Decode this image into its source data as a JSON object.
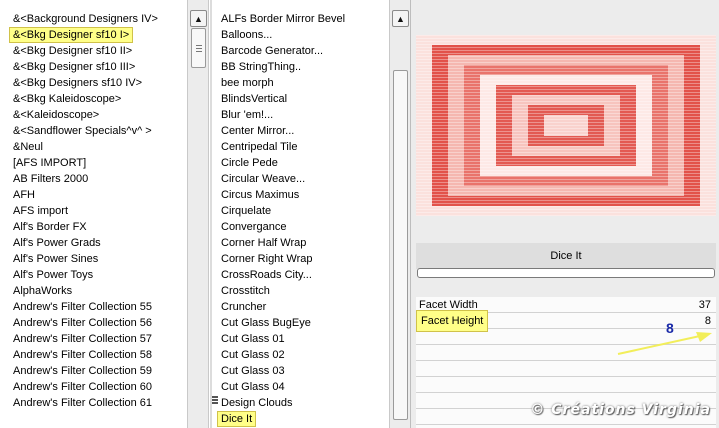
{
  "categories": {
    "items": [
      "&<Background Designers IV>",
      "&<Bkg Designer sf10 I>",
      "&<Bkg Designer sf10 II>",
      "&<Bkg Designer sf10 III>",
      "&<Bkg Designers sf10 IV>",
      "&<Bkg Kaleidoscope>",
      "&<Kaleidoscope>",
      "&<Sandflower Specials^v^ >",
      "&Neul",
      "[AFS IMPORT]",
      "AB Filters 2000",
      "AFH",
      "AFS import",
      "Alf's Border FX",
      "Alf's Power Grads",
      "Alf's Power Sines",
      "Alf's Power Toys",
      "AlphaWorks",
      "Andrew's Filter Collection 55",
      "Andrew's Filter Collection 56",
      "Andrew's Filter Collection 57",
      "Andrew's Filter Collection 58",
      "Andrew's Filter Collection 59",
      "Andrew's Filter Collection 60",
      "Andrew's Filter Collection 61"
    ],
    "selected_index": 1
  },
  "filters": {
    "items": [
      "ALFs Border Mirror Bevel",
      "Balloons...",
      "Barcode Generator...",
      "BB StringThing..",
      "bee morph",
      "BlindsVertical",
      "Blur 'em!...",
      "Center Mirror...",
      "Centripedal Tile",
      "Circle Pede",
      "Circular Weave...",
      "Circus Maximus",
      "Cirquelate",
      "Convergance",
      "Corner Half Wrap",
      "Corner Right Wrap",
      "CrossRoads City...",
      "Crosstitch",
      "Cruncher",
      "Cut Glass  BugEye",
      "Cut Glass 01",
      "Cut Glass 02",
      "Cut Glass 03",
      "Cut Glass 04",
      "Design Clouds",
      "Dice It"
    ],
    "selected_index": 25
  },
  "preview": {
    "filter_name": "Dice It",
    "progress": 0
  },
  "params": [
    {
      "label": "Facet Width",
      "value": "37"
    },
    {
      "label": "Facet Height",
      "value": "8"
    }
  ],
  "annotation": {
    "value": "8"
  },
  "watermark": "© Créations Virginia",
  "colors": {
    "highlight": "#ffff88",
    "annotation_blue": "#1a2aa8",
    "preview_red": "#e2524a",
    "arrow": "#f2ee5a"
  }
}
